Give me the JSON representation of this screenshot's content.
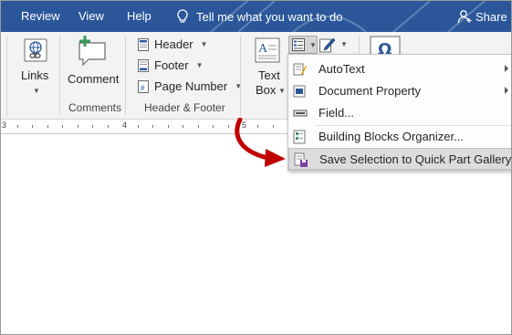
{
  "tabs": {
    "review": "Review",
    "view": "View",
    "help": "Help",
    "tell_me": "Tell me what you want to do",
    "share": "Share"
  },
  "ribbon": {
    "links_label": "Links",
    "comment_label": "Comment",
    "comments_group": "Comments",
    "header_label": "Header",
    "footer_label": "Footer",
    "page_number_label": "Page Number",
    "header_footer_group": "Header & Footer",
    "text_label": "Text",
    "box_label": "Box"
  },
  "ruler": {
    "numbers": [
      "3",
      "4",
      "5"
    ]
  },
  "menu": {
    "items": [
      {
        "label": "AutoText",
        "submenu": true
      },
      {
        "label": "Document Property",
        "submenu": true
      },
      {
        "label": "Field...",
        "submenu": false
      },
      {
        "label": "Building Blocks Organizer...",
        "submenu": false
      },
      {
        "label": "Save Selection to Quick Part Gallery...",
        "submenu": false,
        "highlighted": true
      }
    ]
  },
  "colors": {
    "titlebar": "#2b579a",
    "ribbon": "#f3f3f3",
    "arrow": "#c00000",
    "highlight": "#dcdcdc"
  }
}
